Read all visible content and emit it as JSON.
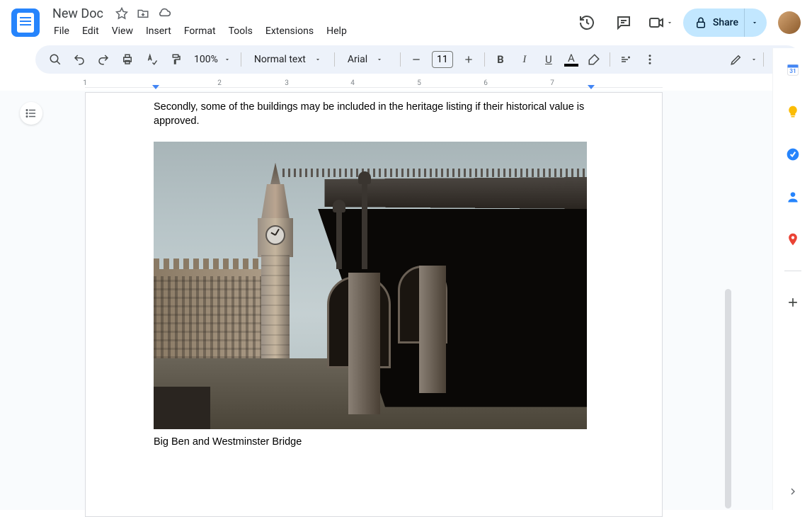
{
  "doc_title": "New Doc",
  "menus": [
    "File",
    "Edit",
    "View",
    "Insert",
    "Format",
    "Tools",
    "Extensions",
    "Help"
  ],
  "share_label": "Share",
  "toolbar": {
    "zoom": "100%",
    "style": "Normal text",
    "font": "Arial",
    "size": "11"
  },
  "ruler_marks": [
    "1",
    "2",
    "3",
    "4",
    "5",
    "6",
    "7"
  ],
  "body_text": "Secondly, some of the buildings may be included in the heritage listing if their historical value is approved.",
  "image_alt": "Big Ben and Westminster Bridge photo",
  "caption": "Big Ben and Westminster Bridge",
  "colors": {
    "share_bg": "#c2e7ff",
    "accent": "#4285f4",
    "toolbar_bg": "#edf2fa",
    "text_underline": "#000000"
  },
  "side_apps": [
    "calendar",
    "keep",
    "tasks",
    "contacts",
    "maps"
  ]
}
